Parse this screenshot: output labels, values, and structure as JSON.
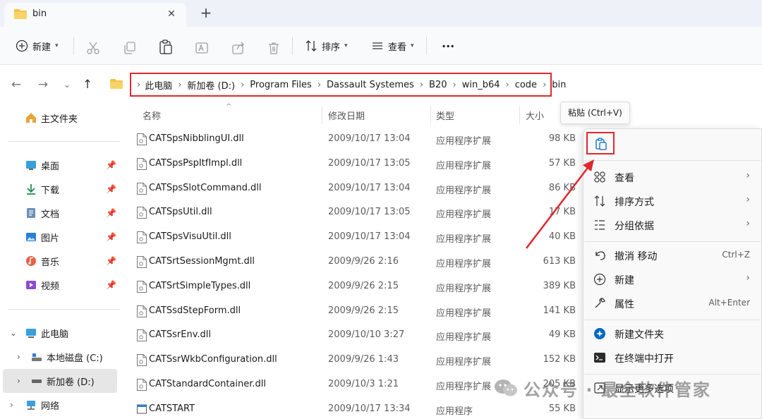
{
  "tab": {
    "title": "bin"
  },
  "toolbar": {
    "new_label": "新建",
    "sort_label": "排序",
    "view_label": "查看",
    "more_label": "···"
  },
  "address": {
    "crumbs": [
      "此电脑",
      "新加卷 (D:)",
      "Program Files",
      "Dassault Systemes",
      "B20",
      "win_b64",
      "code",
      "bin"
    ]
  },
  "navpane": {
    "home": "主文件夹",
    "quick": [
      "桌面",
      "下载",
      "文档",
      "图片",
      "音乐",
      "视频"
    ],
    "thispc": "此电脑",
    "drives": [
      "本地磁盘 (C:)",
      "新加卷 (D:)"
    ],
    "network": "网络"
  },
  "columns": {
    "name": "名称",
    "date": "修改日期",
    "type": "类型",
    "size": "大小"
  },
  "files": [
    {
      "name": "CATSpsNibblingUI.dll",
      "date": "2009/10/17 13:04",
      "type": "应用程序扩展",
      "size": "98 KB"
    },
    {
      "name": "CATSpsPspItfImpl.dll",
      "date": "2009/10/17 13:05",
      "type": "应用程序扩展",
      "size": "57 KB"
    },
    {
      "name": "CATSpsSlotCommand.dll",
      "date": "2009/10/17 13:04",
      "type": "应用程序扩展",
      "size": "86 KB"
    },
    {
      "name": "CATSpsUtil.dll",
      "date": "2009/10/17 13:05",
      "type": "应用程序扩展",
      "size": "17 KB"
    },
    {
      "name": "CATSpsVisuUtil.dll",
      "date": "2009/10/17 13:04",
      "type": "应用程序扩展",
      "size": "40 KB"
    },
    {
      "name": "CATSrtSessionMgmt.dll",
      "date": "2009/9/26 2:16",
      "type": "应用程序扩展",
      "size": "613 KB"
    },
    {
      "name": "CATSrtSimpleTypes.dll",
      "date": "2009/9/26 2:15",
      "type": "应用程序扩展",
      "size": "389 KB"
    },
    {
      "name": "CATSsdStepForm.dll",
      "date": "2009/9/26 2:15",
      "type": "应用程序扩展",
      "size": "141 KB"
    },
    {
      "name": "CATSsrEnv.dll",
      "date": "2009/10/10 3:27",
      "type": "应用程序扩展",
      "size": "49 KB"
    },
    {
      "name": "CATSsrWkbConfiguration.dll",
      "date": "2009/9/26 1:43",
      "type": "应用程序扩展",
      "size": "152 KB"
    },
    {
      "name": "CATStandardContainer.dll",
      "date": "2009/10/3 1:21",
      "type": "应用程序扩展",
      "size": "205 KB"
    },
    {
      "name": "CATSTART",
      "date": "2009/10/17 13:34",
      "type": "应用程序",
      "size": "55 KB"
    }
  ],
  "tooltip": {
    "text": "粘贴 (Ctrl+V)"
  },
  "contextmenu": {
    "view": "查看",
    "sort": "排序方式",
    "group": "分组依据",
    "undo": "撤消 移动",
    "undo_shortcut": "Ctrl+Z",
    "new": "新建",
    "properties": "属性",
    "properties_shortcut": "Alt+Enter",
    "new_folder": "新建文件夹",
    "terminal": "在终端中打开",
    "more": "显示更多选项"
  },
  "watermark": {
    "text": "公众号 · 最全软件管家"
  },
  "colors": {
    "highlight_red": "#e0272e",
    "folder_yellow": "#f5c242",
    "accent_blue": "#0067c0"
  }
}
